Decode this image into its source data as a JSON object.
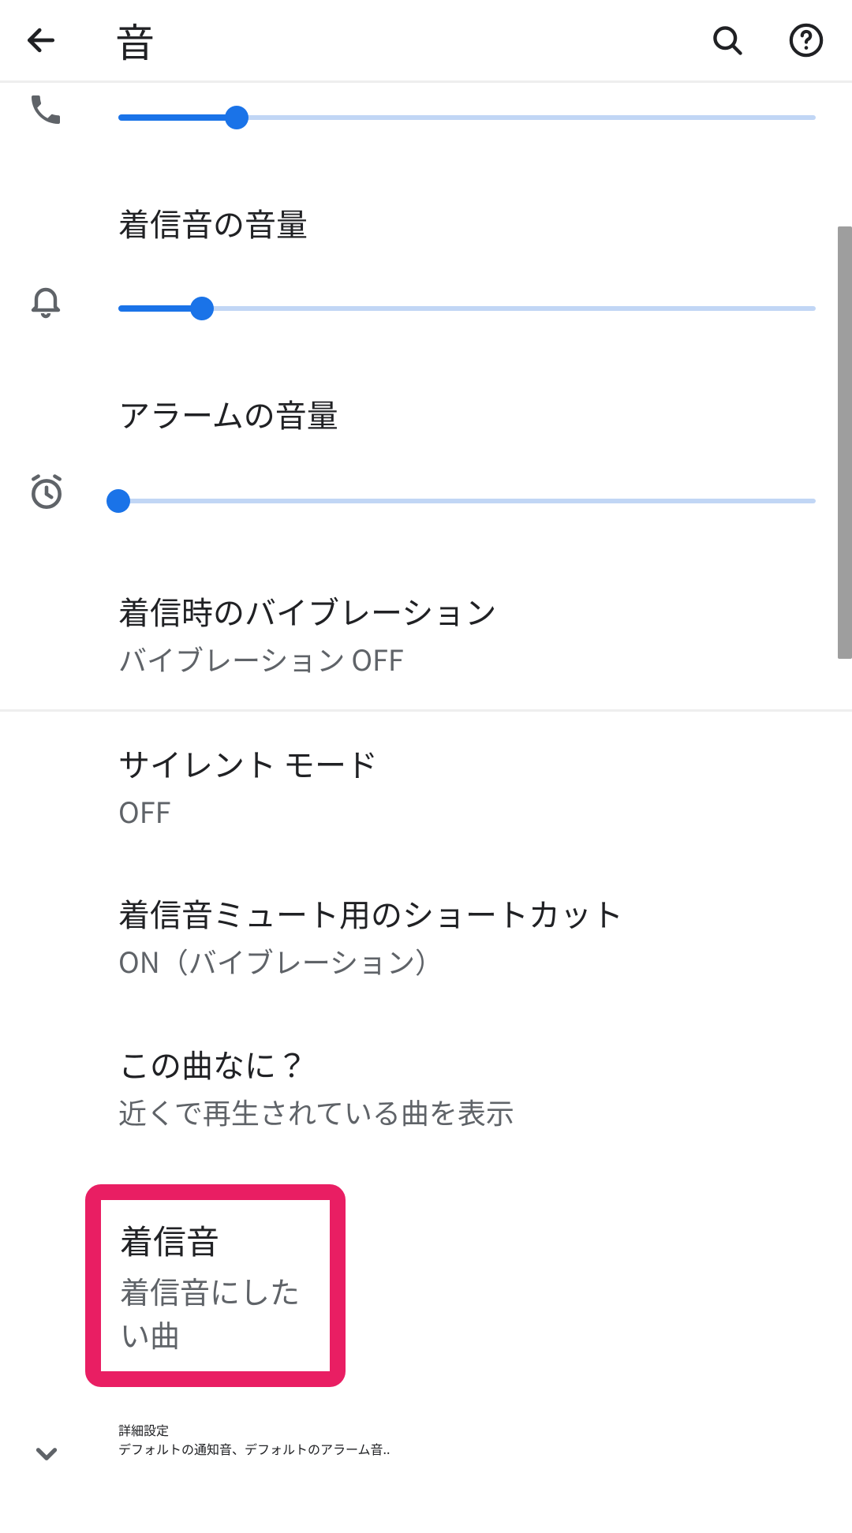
{
  "header": {
    "title": "音"
  },
  "sliders": {
    "call": {
      "value_percent": 17,
      "label": ""
    },
    "ring": {
      "value_percent": 12,
      "label": "着信音の音量"
    },
    "alarm": {
      "value_percent": 0,
      "label": "アラームの音量"
    }
  },
  "items": {
    "vibration": {
      "title": "着信時のバイブレーション",
      "subtitle": "バイブレーション OFF"
    },
    "silent": {
      "title": "サイレント モード",
      "subtitle": "OFF"
    },
    "mute_shortcut": {
      "title": "着信音ミュート用のショートカット",
      "subtitle": "ON（バイブレーション）"
    },
    "now_playing": {
      "title": "この曲なに？",
      "subtitle": "近くで再生されている曲を表示"
    },
    "ringtone": {
      "title": "着信音",
      "subtitle": "着信音にしたい曲"
    },
    "advanced": {
      "title": "詳細設定",
      "subtitle": "デフォルトの通知音、デフォルトのアラーム音.."
    }
  },
  "colors": {
    "accent": "#1a73e8",
    "highlight": "#e91e63",
    "text_secondary": "#5f6368"
  }
}
